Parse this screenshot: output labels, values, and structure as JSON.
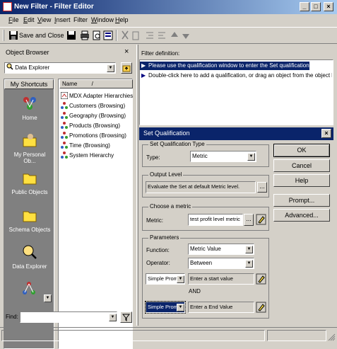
{
  "window": {
    "title": "New Filter - Filter Editor",
    "controls": [
      "_",
      "□",
      "×"
    ]
  },
  "menu": [
    {
      "label": "File",
      "u": "F",
      "rest": "ile"
    },
    {
      "label": "Edit",
      "u": "E",
      "rest": "dit"
    },
    {
      "label": "View",
      "u": "V",
      "rest": "iew"
    },
    {
      "label": "Insert",
      "u": "I",
      "rest": "nsert"
    },
    {
      "label": "Filter",
      "u": "",
      "rest": "Filter"
    },
    {
      "label": "Window",
      "u": "W",
      "rest": "indow"
    },
    {
      "label": "Help",
      "u": "H",
      "rest": "elp"
    }
  ],
  "toolbar": {
    "save_close": "Save and Close"
  },
  "object_browser": {
    "title": "Object Browser",
    "close": "×",
    "location": "Data Explorer",
    "shortcuts_label": "My Shortcuts",
    "column_name": "Name",
    "column_sort": "/",
    "items": [
      "MDX Adapter Hierarchies",
      "Customers (Browsing)",
      "Geography (Browsing)",
      "Products (Browsing)",
      "Promotions (Browsing)",
      "Time (Browsing)",
      "System Hierarchy"
    ],
    "shortcuts": [
      "Home",
      "My Personal Ob...",
      "Public Objects",
      "Schema Objects",
      "Data Explorer"
    ],
    "find_label": "Find:"
  },
  "filter_definition": {
    "title": "Filter definition:",
    "line1": "Please use the qualification window to enter the Set qualification.",
    "line2": "Double-click here to add a qualification, or drag an object from the object b"
  },
  "set_qualification": {
    "title": "Set Qualification",
    "close": "×",
    "type_group": "Set Qualification Type",
    "type_label": "Type:",
    "type_value": "Metric",
    "output_group": "Output Level",
    "output_value": "Evaluate the Set at default Metric level.",
    "ellipsis": "...",
    "metric_group": "Choose a metric",
    "metric_label": "Metric:",
    "metric_value": "test profit level metric",
    "params_group": "Parameters",
    "function_label": "Function:",
    "function_value": "Metric Value",
    "operator_label": "Operator:",
    "operator_value": "Between",
    "start_type": "Simple Prom",
    "start_value": "Enter a start value",
    "and_label": "AND",
    "end_type": "Simple Prom",
    "end_value": "Enter a  End Value",
    "buttons": {
      "ok": "OK",
      "cancel": "Cancel",
      "help": "Help",
      "prompt": "Prompt...",
      "advanced": "Advanced..."
    }
  }
}
